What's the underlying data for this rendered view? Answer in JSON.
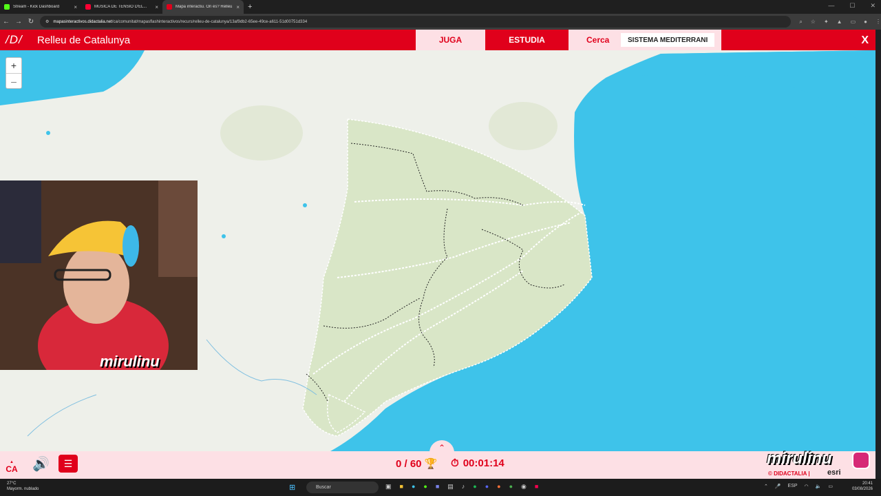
{
  "browser": {
    "tabs": [
      {
        "label": "Stream - Kick Dashboard",
        "color": "#53fc18"
      },
      {
        "label": "MÚSICA DE TENSIÓ D'EL...",
        "color": "#ff0033"
      },
      {
        "label": "Mapa interactiu. On és? Relleu...",
        "color": "#e0001b"
      }
    ],
    "url_domain": "mapasinteractivos.didactalia.net",
    "url_path": "/ca/comunitat/mapasflashinteractivos/recurs/relleu-de-catalunya/13af9db2-65ee-49ce-a611-51d00751d334"
  },
  "header": {
    "logo": "/D/",
    "title": "Relleu de Catalunya",
    "play_label": "JUGA",
    "study_label": "ESTUDIA",
    "search_label": "Cerca",
    "search_value": "SISTEMA MEDITERRANI",
    "close_label": "X"
  },
  "zoom": {
    "in": "+",
    "out": "–"
  },
  "footer": {
    "lang": "CA",
    "score": "0 / 60",
    "time": "00:01:14"
  },
  "overlay": {
    "streamer_name": "mirulinu",
    "brand": "© DIDACTALIA |",
    "esri": "esri"
  },
  "taskbar": {
    "temp": "27°C",
    "weather": "Mayorm. nublado",
    "search": "Buscar",
    "lang": "ESP",
    "time": "20:41",
    "date": "03/08/2026"
  },
  "colors": {
    "accent": "#e0001b",
    "accent_light": "#fde0e5",
    "sea": "#3ec3ea"
  }
}
